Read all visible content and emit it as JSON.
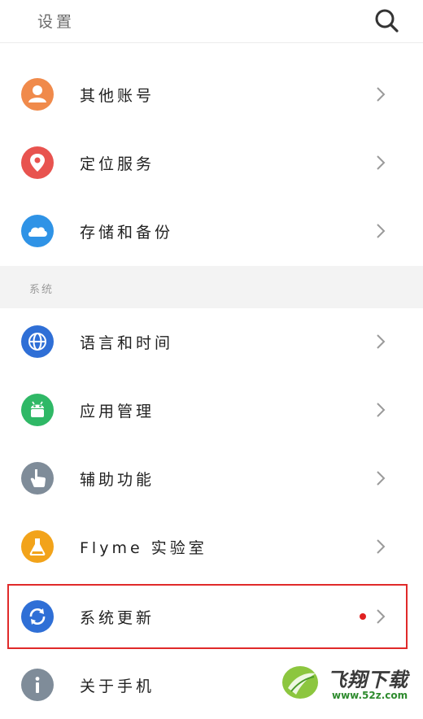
{
  "header": {
    "title": "设置",
    "search_icon": "search-icon"
  },
  "items_top": [
    {
      "label": "其他账号",
      "icon": "person-icon",
      "color": "#f08a4b"
    },
    {
      "label": "定位服务",
      "icon": "location-pin-icon",
      "color": "#e8534f"
    },
    {
      "label": "存储和备份",
      "icon": "cloud-icon",
      "color": "#2f93e6"
    }
  ],
  "section": {
    "label": "系统"
  },
  "items_system": [
    {
      "label": "语言和时间",
      "icon": "globe-icon",
      "color": "#2f6fd6"
    },
    {
      "label": "应用管理",
      "icon": "android-icon",
      "color": "#2fb866"
    },
    {
      "label": "辅助功能",
      "icon": "hand-pointer-icon",
      "color": "#7f8c99"
    },
    {
      "label": "Flyme 实验室",
      "icon": "flask-icon",
      "color": "#f2a31a"
    },
    {
      "label": "系统更新",
      "icon": "refresh-icon",
      "color": "#2f6fd6",
      "has_badge": true,
      "badge_color": "#e02020"
    },
    {
      "label": "关于手机",
      "icon": "info-icon",
      "color": "#7f8c99"
    }
  ],
  "highlight_color": "#e02a2a",
  "watermark": {
    "title": "飞翔下载",
    "url": "www.52z.com"
  }
}
